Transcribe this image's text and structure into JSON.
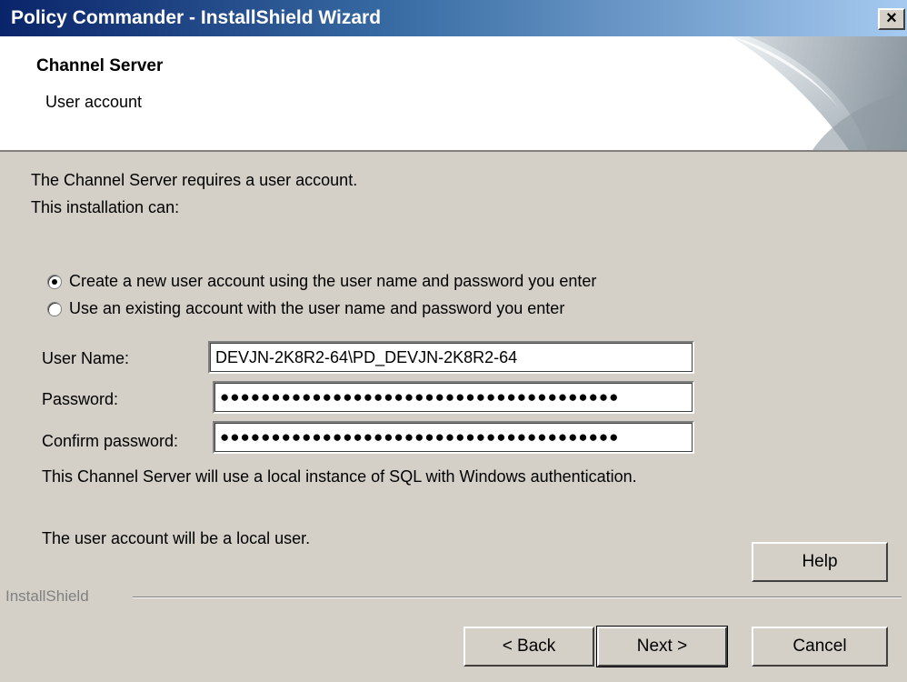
{
  "window": {
    "title": "Policy Commander - InstallShield Wizard",
    "close_glyph": "×"
  },
  "header": {
    "title": "Channel Server",
    "subtitle": "User account"
  },
  "intro": {
    "line1": "The Channel Server requires a user account.",
    "line2": "This installation can:"
  },
  "options": [
    {
      "label": "Create a new user account using the user name and password you enter",
      "selected": true
    },
    {
      "label": "Use an existing account with the user name and password you enter",
      "selected": false
    }
  ],
  "form": {
    "username_label": "User Name:",
    "username_value": "DEVJN-2K8R2-64\\PD_DEVJN-2K8R2-64",
    "password_label": "Password:",
    "password_value": "●●●●●●●●●●●●●●●●●●●●●●●●●●●●●●●●●●●●●●●",
    "confirm_label": "Confirm password:",
    "confirm_value": "●●●●●●●●●●●●●●●●●●●●●●●●●●●●●●●●●●●●●●●"
  },
  "notes": {
    "sql": "This Channel Server will use a local instance of SQL with Windows authentication.",
    "local_user": "The user account will be a local user."
  },
  "footer": {
    "brand": "InstallShield",
    "help_label": "Help",
    "back_label": "< Back",
    "next_label": "Next >",
    "cancel_label": "Cancel"
  },
  "colors": {
    "titlebar_start": "#0a246a",
    "titlebar_end": "#a6caf0",
    "dialog_bg": "#d4d0c8"
  },
  "icons": {
    "close": "close-icon",
    "banner": "page-curl-graphic"
  }
}
